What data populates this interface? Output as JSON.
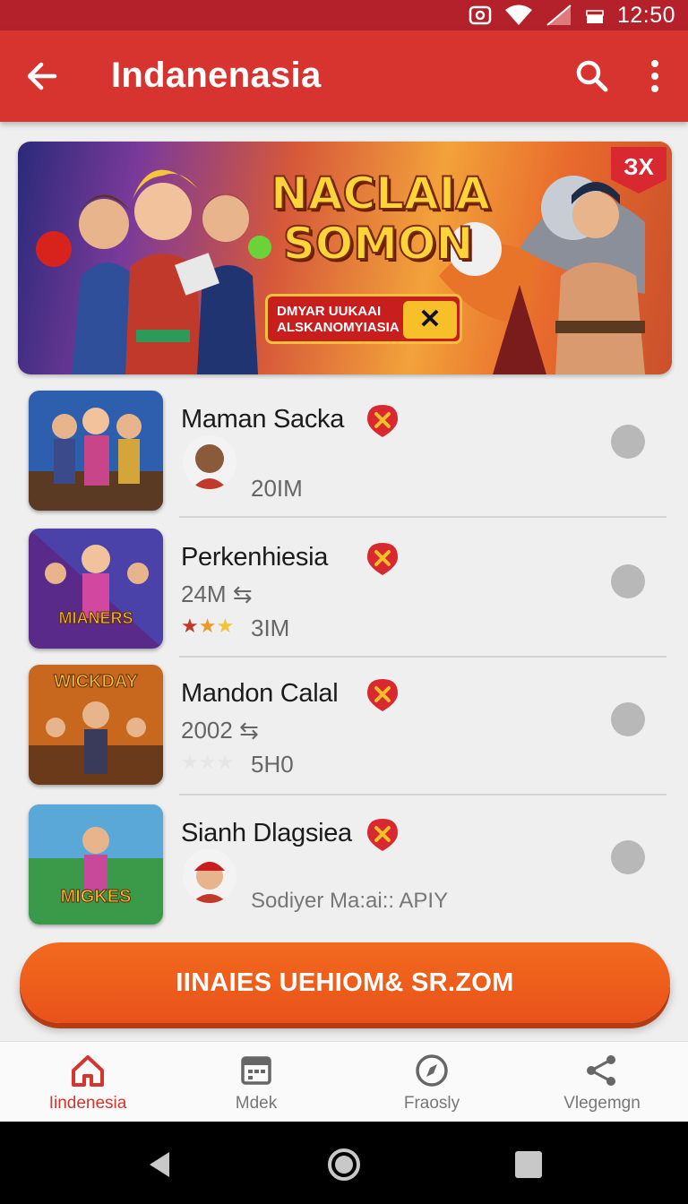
{
  "status_bar": {
    "time": "12:50"
  },
  "app_bar": {
    "title": "Indanenasia"
  },
  "banner": {
    "title_line1": "NACLAIA",
    "title_line2": "SOMON",
    "subtitle_line1": "DMYAR UUKAAI",
    "subtitle_line2": "ALSKANOMYIASIA",
    "badge": "ЗX"
  },
  "games": [
    {
      "name": "Maman Sacka",
      "meta1": "",
      "meta2": "20IM",
      "has_avatar": true,
      "rating": 0
    },
    {
      "name": "Perkenhiesia",
      "meta1": "24M",
      "meta2": "3IM",
      "has_avatar": false,
      "rating": 3
    },
    {
      "name": "Mandon Calal",
      "meta1": "2002",
      "meta2": "5H0",
      "has_avatar": false,
      "rating": 0
    },
    {
      "name": "Sianh Dlagsiea",
      "meta1": "",
      "meta2": "Sodiyer Ma:ai:: APIY",
      "has_avatar": true,
      "rating": 0
    }
  ],
  "thumb_labels": [
    "",
    "MIANERS",
    "WICKDAY",
    "MIGKES"
  ],
  "cta": {
    "label": "IINAIES UEHIOM& SR.ZOM"
  },
  "bottom_nav": [
    {
      "label": "Iindenesia",
      "icon": "home-icon",
      "active": true
    },
    {
      "label": "Mdek",
      "icon": "calendar-icon",
      "active": false
    },
    {
      "label": "Fraosly",
      "icon": "compass-icon",
      "active": false
    },
    {
      "label": "Vlegemgn",
      "icon": "share-icon",
      "active": false
    }
  ],
  "colors": {
    "primary": "#d7342f",
    "status_bar": "#b5212b",
    "cta": "#ea561a",
    "badge": "#d9282f"
  }
}
